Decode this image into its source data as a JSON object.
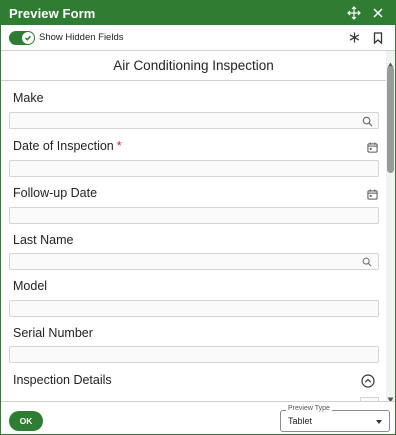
{
  "window": {
    "title": "Preview Form"
  },
  "toolbar": {
    "toggle_label": "Show Hidden Fields",
    "toggle_on": true
  },
  "form": {
    "title": "Air Conditioning Inspection",
    "fields": [
      {
        "label": "Make",
        "value": "",
        "icon": "search-icon"
      },
      {
        "label": "Date of Inspection",
        "required_mark": "*",
        "value": "",
        "icon": "calendar-icon"
      },
      {
        "label": "Follow-up Date",
        "value": "",
        "icon": "calendar-icon"
      },
      {
        "label": "Last Name",
        "value": "",
        "icon": "search-icon"
      },
      {
        "label": "Model",
        "value": ""
      },
      {
        "label": "Serial Number",
        "value": ""
      }
    ],
    "section": {
      "label": "Inspection Details",
      "icon": "collapse-up-icon"
    }
  },
  "footer": {
    "ok_label": "OK",
    "preview_type": {
      "legend": "Preview Type",
      "value": "Tablet"
    }
  },
  "colors": {
    "brand_green": "#2e7d32",
    "required_red": "#c62828"
  }
}
